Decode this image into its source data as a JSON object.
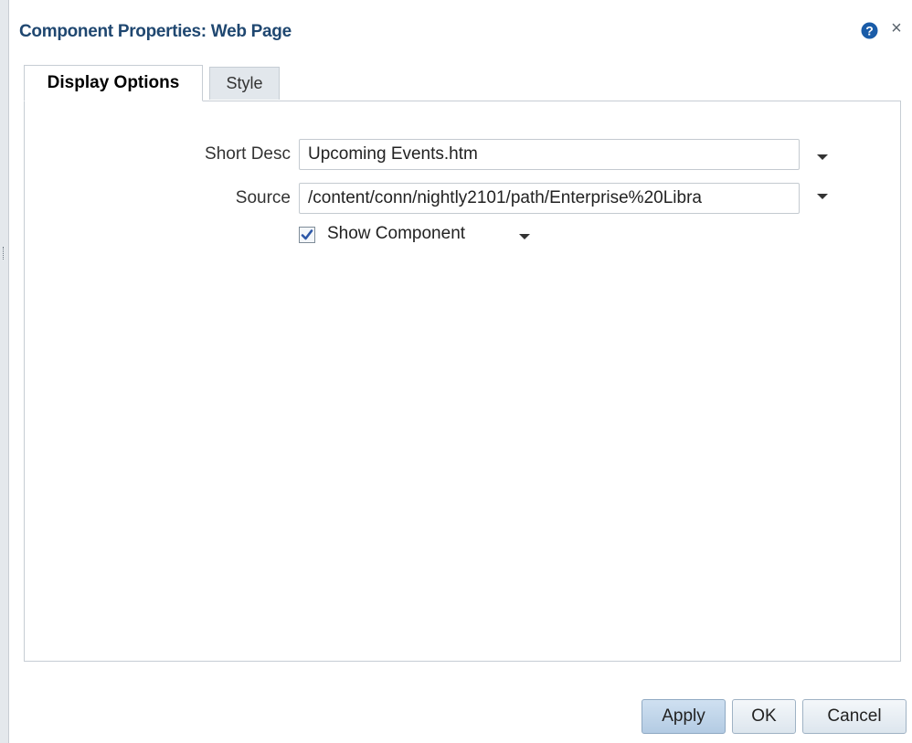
{
  "dialog": {
    "title": "Component Properties: Web Page",
    "help_icon": "help-icon",
    "close_icon": "close-icon",
    "close_glyph": "×"
  },
  "tabs": [
    {
      "label": "Display Options",
      "active": true
    },
    {
      "label": "Style",
      "active": false
    }
  ],
  "form": {
    "short_desc": {
      "label": "Short Desc",
      "value": "Upcoming Events.htm"
    },
    "source": {
      "label": "Source",
      "value": "/content/conn/nightly2101/path/Enterprise%20Libra"
    },
    "show_component": {
      "label": "Show Component",
      "checked": true
    }
  },
  "buttons": {
    "apply": "Apply",
    "ok": "OK",
    "cancel": "Cancel"
  },
  "colors": {
    "title": "#1f4770",
    "help_icon": "#1a5ca8",
    "check": "#2d58a8"
  }
}
